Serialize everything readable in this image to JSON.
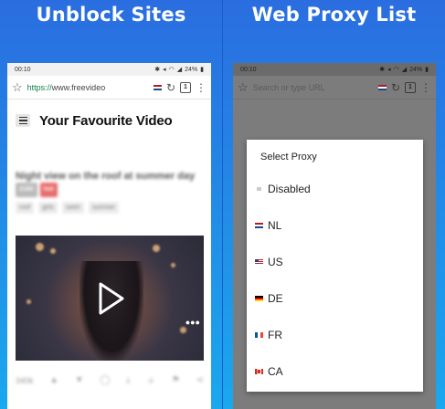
{
  "left_panel": {
    "title": "Unblock Sites",
    "status": {
      "time": "00:10",
      "battery": "24%"
    },
    "url": {
      "scheme": "https://",
      "host": "www.freevideo",
      "tab_count": "1"
    },
    "site_title": "Your Favourite Video",
    "video": {
      "title": "Night view on the roof at summer day",
      "badges": [
        "2160",
        "hot"
      ],
      "tags": [
        "roof",
        "girls",
        "swim",
        "summer"
      ],
      "views": "340k"
    }
  },
  "right_panel": {
    "title": "Web Proxy List",
    "status": {
      "time": "00:10",
      "battery": "24%"
    },
    "url": {
      "placeholder": "Search or type URL",
      "tab_count": "1"
    },
    "dialog": {
      "title": "Select Proxy",
      "options": [
        {
          "label": "Disabled",
          "flag": "none"
        },
        {
          "label": "NL",
          "flag": "nl"
        },
        {
          "label": "US",
          "flag": "us"
        },
        {
          "label": "DE",
          "flag": "de"
        },
        {
          "label": "FR",
          "flag": "fr"
        },
        {
          "label": "CA",
          "flag": "ca"
        }
      ]
    }
  },
  "colors": {
    "background_top": "#2a6de0",
    "background_bottom": "#1aa8ee",
    "url_scheme": "#0b8043"
  }
}
